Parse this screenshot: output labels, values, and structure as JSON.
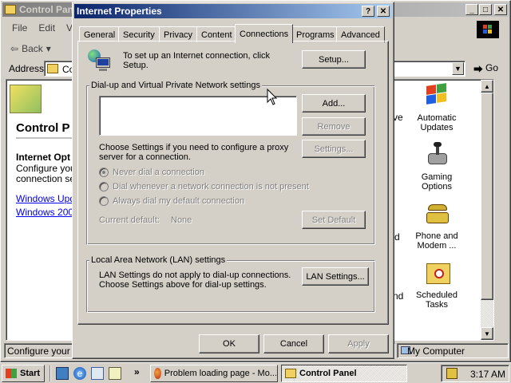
{
  "bg_window": {
    "title": "Control Panel",
    "menu": [
      "File",
      "Edit",
      "V"
    ],
    "back_label": "Back",
    "address_label": "Address",
    "address_value": "Co",
    "go_label": "Go",
    "heading": "Control P",
    "section_title": "Internet Opt",
    "section_text_1": "Configure your",
    "section_text_2": "connection se",
    "link_1": "Windows Upd",
    "link_2": "Windows 2000",
    "status_left": "Configure your In",
    "status_right": "My Computer",
    "partial_labels": [
      "ve",
      "d",
      "nd"
    ],
    "icons": [
      {
        "label": "Automatic Updates",
        "icon": "windows-flag-icon"
      },
      {
        "label": "Gaming Options",
        "icon": "joystick-icon"
      },
      {
        "label": "Phone and Modem ...",
        "icon": "phone-icon"
      },
      {
        "label": "Scheduled Tasks",
        "icon": "folder-clock-icon"
      }
    ]
  },
  "dialog": {
    "title": "Internet Properties",
    "help_label": "?",
    "close_label": "✕",
    "tabs": [
      "General",
      "Security",
      "Privacy",
      "Content",
      "Connections",
      "Programs",
      "Advanced"
    ],
    "active_tab": "Connections",
    "setup_text": "To set up an Internet connection, click Setup.",
    "setup_button": "Setup...",
    "dialup_group_label": "Dial-up and Virtual Private Network settings",
    "add_button": "Add...",
    "remove_button": "Remove",
    "settings_button": "Settings...",
    "choose_settings_text": "Choose Settings if you need to configure a proxy server for a connection.",
    "radio_options": [
      {
        "label": "Never dial a connection",
        "checked": true
      },
      {
        "label": "Dial whenever a network connection is not present",
        "checked": false
      },
      {
        "label": "Always dial my default connection",
        "checked": false
      }
    ],
    "current_default_label": "Current default:",
    "current_default_value": "None",
    "set_default_button": "Set Default",
    "lan_group_label": "Local Area Network (LAN) settings",
    "lan_text": "LAN Settings do not apply to dial-up connections. Choose Settings above for dial-up settings.",
    "lan_button": "LAN Settings...",
    "ok_button": "OK",
    "cancel_button": "Cancel",
    "apply_button": "Apply"
  },
  "taskbar": {
    "start_label": "Start",
    "quick_launch": [
      "desktop-icon",
      "ie-icon",
      "outlook-icon",
      "search-icon"
    ],
    "more_label": "»",
    "tasks": [
      {
        "label": "Problem loading page - Mo...",
        "icon": "firefox-icon",
        "active": false
      },
      {
        "label": "Control Panel",
        "icon": "control-panel-icon",
        "active": true
      }
    ],
    "clock": "3:17 AM"
  },
  "colors": {
    "titlebar_active": "#0a246a",
    "window_face": "#d4d0c8",
    "link": "#0000ee"
  }
}
